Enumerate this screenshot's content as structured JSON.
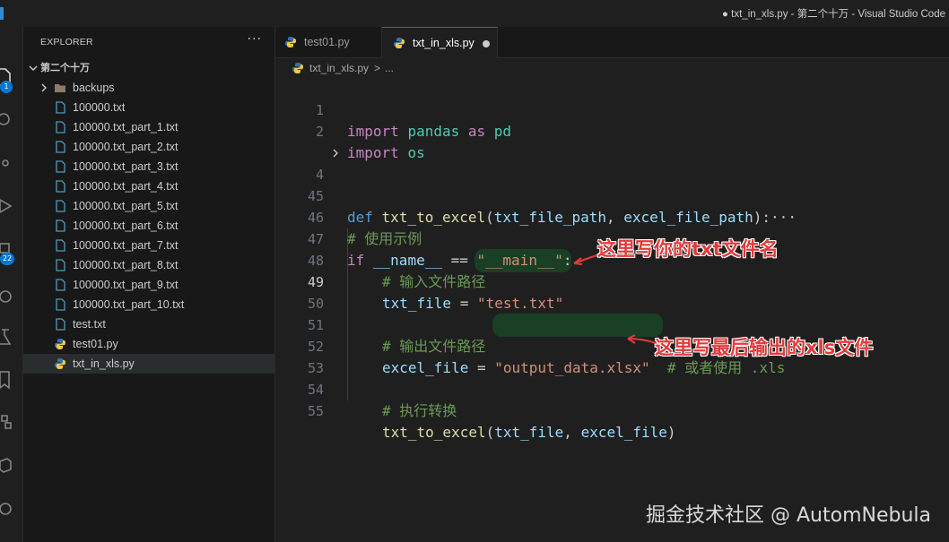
{
  "window": {
    "title": "● txt_in_xls.py - 第二个十万 - Visual Studio Code"
  },
  "activity_bar": {
    "badges": {
      "explorer": "1",
      "extensions": "22"
    }
  },
  "explorer": {
    "header": "EXPLORER",
    "more": "···",
    "root_folder": "第二个十万",
    "items": [
      {
        "label": "backups",
        "type": "folder"
      },
      {
        "label": "100000.txt",
        "type": "txt"
      },
      {
        "label": "100000.txt_part_1.txt",
        "type": "txt"
      },
      {
        "label": "100000.txt_part_2.txt",
        "type": "txt"
      },
      {
        "label": "100000.txt_part_3.txt",
        "type": "txt"
      },
      {
        "label": "100000.txt_part_4.txt",
        "type": "txt"
      },
      {
        "label": "100000.txt_part_5.txt",
        "type": "txt"
      },
      {
        "label": "100000.txt_part_6.txt",
        "type": "txt"
      },
      {
        "label": "100000.txt_part_7.txt",
        "type": "txt"
      },
      {
        "label": "100000.txt_part_8.txt",
        "type": "txt"
      },
      {
        "label": "100000.txt_part_9.txt",
        "type": "txt"
      },
      {
        "label": "100000.txt_part_10.txt",
        "type": "txt"
      },
      {
        "label": "test.txt",
        "type": "txt"
      },
      {
        "label": "test01.py",
        "type": "py"
      },
      {
        "label": "txt_in_xls.py",
        "type": "py",
        "selected": true
      }
    ]
  },
  "tabs": [
    {
      "label": "test01.py",
      "active": false
    },
    {
      "label": "txt_in_xls.py",
      "active": true,
      "modified": true
    }
  ],
  "breadcrumb": {
    "file": "txt_in_xls.py",
    "sep": ">",
    "rest": "..."
  },
  "code": {
    "line_numbers": [
      "1",
      "2",
      "",
      "4",
      "45",
      "46",
      "47",
      "48",
      "49",
      "50",
      "51",
      "52",
      "53",
      "54",
      "55"
    ],
    "current_line": "49",
    "l1": {
      "kw": "import",
      "mod": "pandas",
      "kw2": "as",
      "alias": "pd"
    },
    "l2": {
      "kw": "import",
      "mod": "os"
    },
    "l4": {
      "kw": "def",
      "fn": "txt_to_excel",
      "p1": "txt_file_path",
      "p2": "excel_file_path",
      "tail": "):",
      "ellipsis": "···"
    },
    "l46": "# 使用示例",
    "l47": {
      "kw": "if",
      "var": "__name__",
      "op": "==",
      "str": "\"__main__\"",
      "tail": ":"
    },
    "l48": "# 输入文件路径",
    "l49": {
      "var": "txt_file",
      "op": "=",
      "str": "\"test.txt\""
    },
    "l51": "# 输出文件路径",
    "l52": {
      "var": "excel_file",
      "op": "=",
      "str": "\"output_data.xlsx\"",
      "comment": "# 或者使用 .xls"
    },
    "l54": "# 执行转换",
    "l55": {
      "fn": "txt_to_excel",
      "a1": "txt_file",
      "a2": "excel_file"
    }
  },
  "annotations": {
    "a1": "这里写你的txt文件名",
    "a2": "这里写最后输出的xls文件"
  },
  "watermark": "掘金技术社区 @ AutomNebula",
  "colors": {
    "annotation_red": "#e23b3b",
    "accent_blue": "#0078d4",
    "highlight_green": "#145a28"
  }
}
